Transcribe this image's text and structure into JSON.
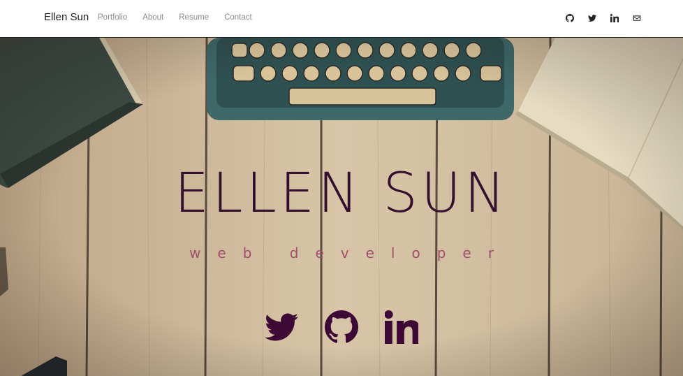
{
  "nav": {
    "brand": "Ellen Sun",
    "links": [
      "Portfolio",
      "About",
      "Resume",
      "Contact"
    ],
    "icons": [
      "github-icon",
      "twitter-icon",
      "linkedin-icon",
      "mail-icon"
    ]
  },
  "hero": {
    "name": "ELLEN SUN",
    "tagline": "web developer",
    "social_icons": [
      "twitter-icon",
      "github-icon",
      "linkedin-icon"
    ],
    "colors": {
      "name": "#34102e",
      "tagline": "#a0506b",
      "icons": "#3d0a36"
    }
  }
}
